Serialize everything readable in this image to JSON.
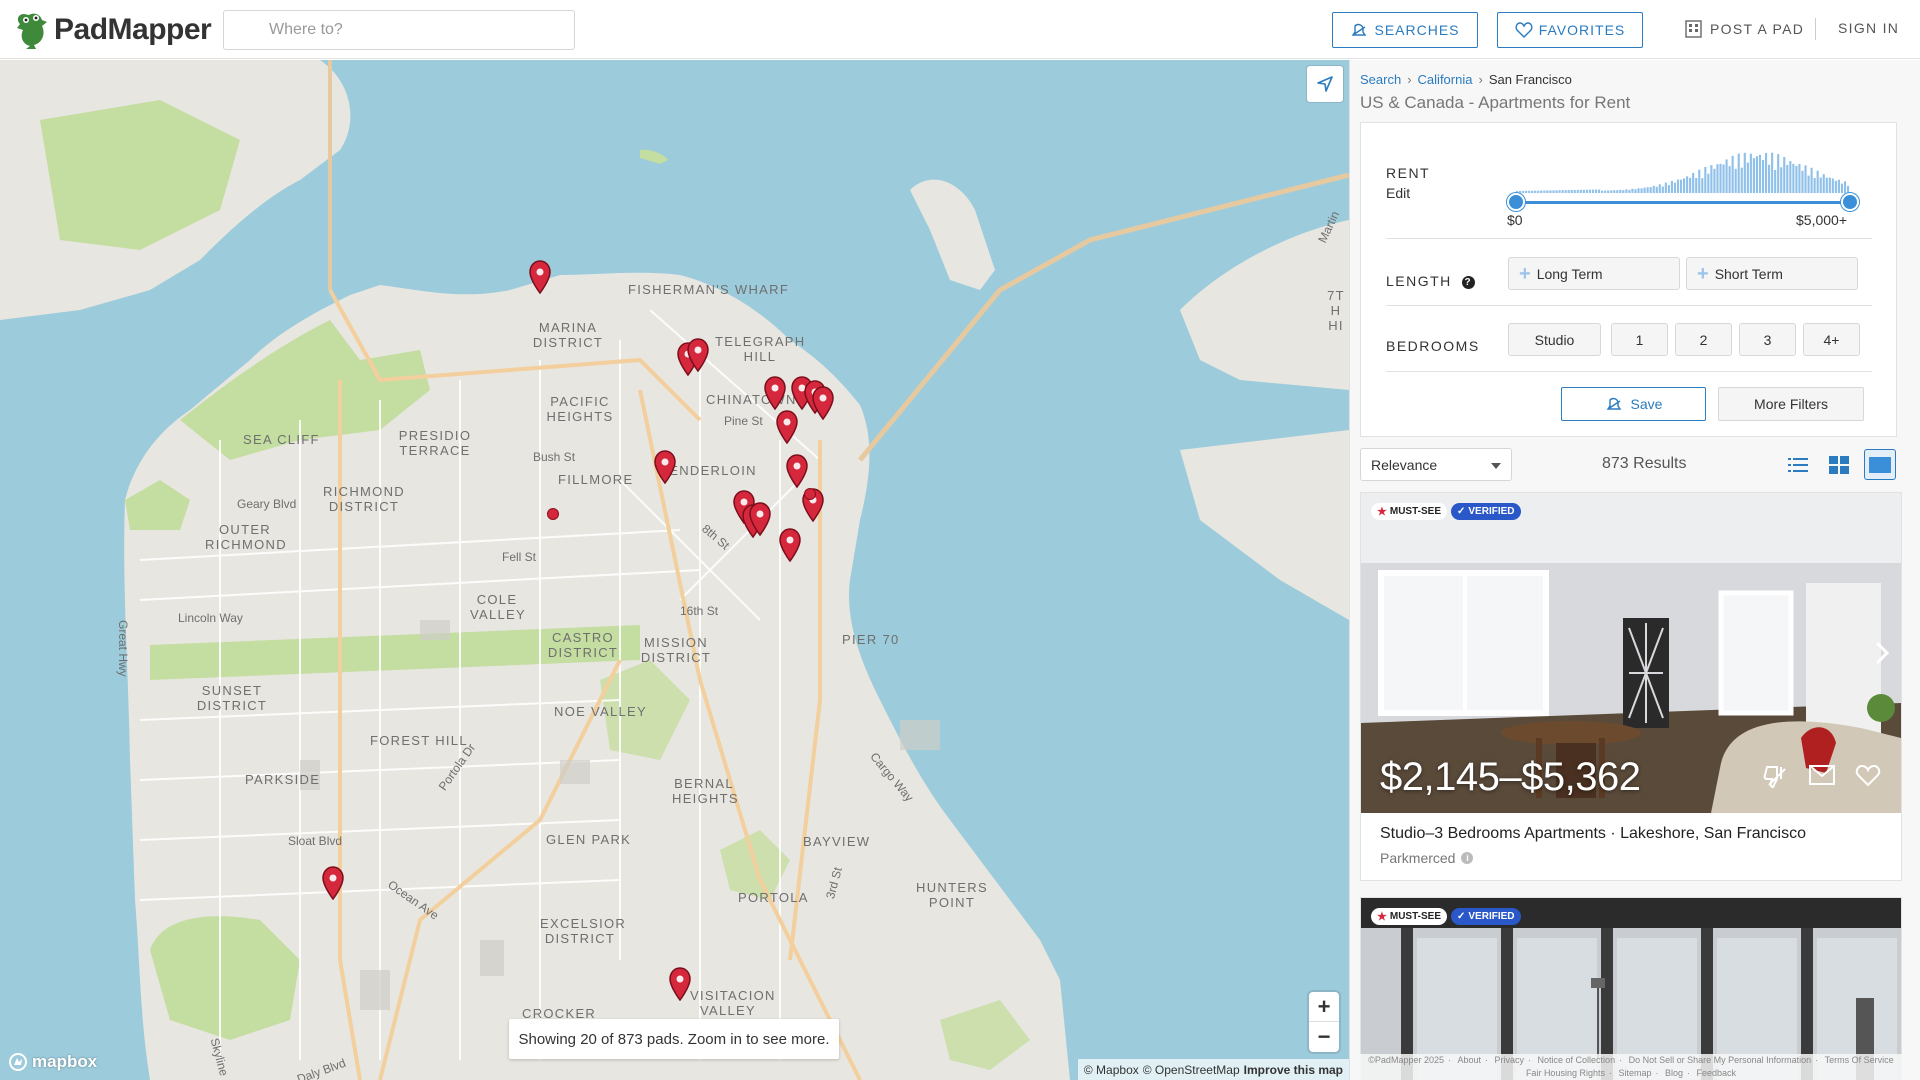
{
  "header": {
    "logo_text": "PadMapper",
    "search_placeholder": "Where to?",
    "searches_label": "SEARCHES",
    "favorites_label": "FAVORITES",
    "post_label": "POST A PAD",
    "signin_label": "SIGN IN",
    "accent_color": "#2a7bbf"
  },
  "map": {
    "neighborhoods": [
      "FISHERMAN'S WHARF",
      "TELEGRAPH HILL",
      "MARINA DISTRICT",
      "PACIFIC HEIGHTS",
      "CHINATOWN",
      "SEA CLIFF",
      "PRESIDIO TERRACE",
      "RICHMOND DISTRICT",
      "OUTER RICHMOND",
      "FILLMORE",
      "TENDERLOIN",
      "COLE VALLEY",
      "CASTRO DISTRICT",
      "MISSION DISTRICT",
      "SUNSET DISTRICT",
      "NOE VALLEY",
      "FOREST HILL",
      "PARKSIDE",
      "BERNAL HEIGHTS",
      "GLEN PARK",
      "BAYVIEW",
      "HUNTERS POINT",
      "PORTOLA",
      "EXCELSIOR DISTRICT",
      "VISITACION VALLEY",
      "CROCKER",
      "PIER 70",
      "7TH HI"
    ],
    "streets": [
      "Geary Blvd",
      "Bush St",
      "Pine St",
      "Fell St",
      "Lincoln Way",
      "Great Hwy",
      "16th St",
      "8th St",
      "Sloat Blvd",
      "Ocean Ave",
      "Portola Dr",
      "Cargo Way",
      "3rd St",
      "Skyline",
      "Daly Blvd",
      "Martin"
    ],
    "showing_text": "Showing 20 of 873 pads. Zoom in to see more.",
    "zoom_in": "+",
    "zoom_out": "−",
    "mapbox_label": "mapbox",
    "attribution_mapbox": "© Mapbox",
    "attribution_osm": "© OpenStreetMap",
    "attribution_improve": "Improve this map",
    "pin_color": "#d6283c",
    "water_color": "#9ccbdb",
    "land_color": "#e8e6e0",
    "park_color": "#c4dda0"
  },
  "panel": {
    "breadcrumb": [
      "Search",
      "California",
      "San Francisco"
    ],
    "title": "US & Canada - Apartments for Rent",
    "rent_label": "RENT",
    "rent_edit": "Edit",
    "rent_min": "$0",
    "rent_max": "$5,000+",
    "length_label": "LENGTH",
    "length_help": "?",
    "length_options": [
      "Long Term",
      "Short Term"
    ],
    "bedrooms_label": "BEDROOMS",
    "bedroom_options": [
      "Studio",
      "1",
      "2",
      "3",
      "4+"
    ],
    "save_label": "Save",
    "more_filters_label": "More Filters",
    "sort_value": "Relevance",
    "results_count": "873 Results"
  },
  "listings": [
    {
      "badge_must": "MUST-SEE",
      "badge_verified": "VERIFIED",
      "price": "$2,145–$5,362",
      "title": "Studio–3 Bedrooms Apartments · Lakeshore, San Francisco",
      "subtitle": "Parkmerced"
    },
    {
      "badge_must": "MUST-SEE",
      "badge_verified": "VERIFIED"
    }
  ],
  "footer": {
    "links_row1": [
      "©PadMapper 2025",
      "About",
      "Privacy",
      "Notice of Collection",
      "Do Not Sell or Share My Personal Information",
      "Terms Of Service"
    ],
    "links_row2": [
      "Fair Housing Rights",
      "Sitemap",
      "Blog",
      "Feedback"
    ]
  }
}
